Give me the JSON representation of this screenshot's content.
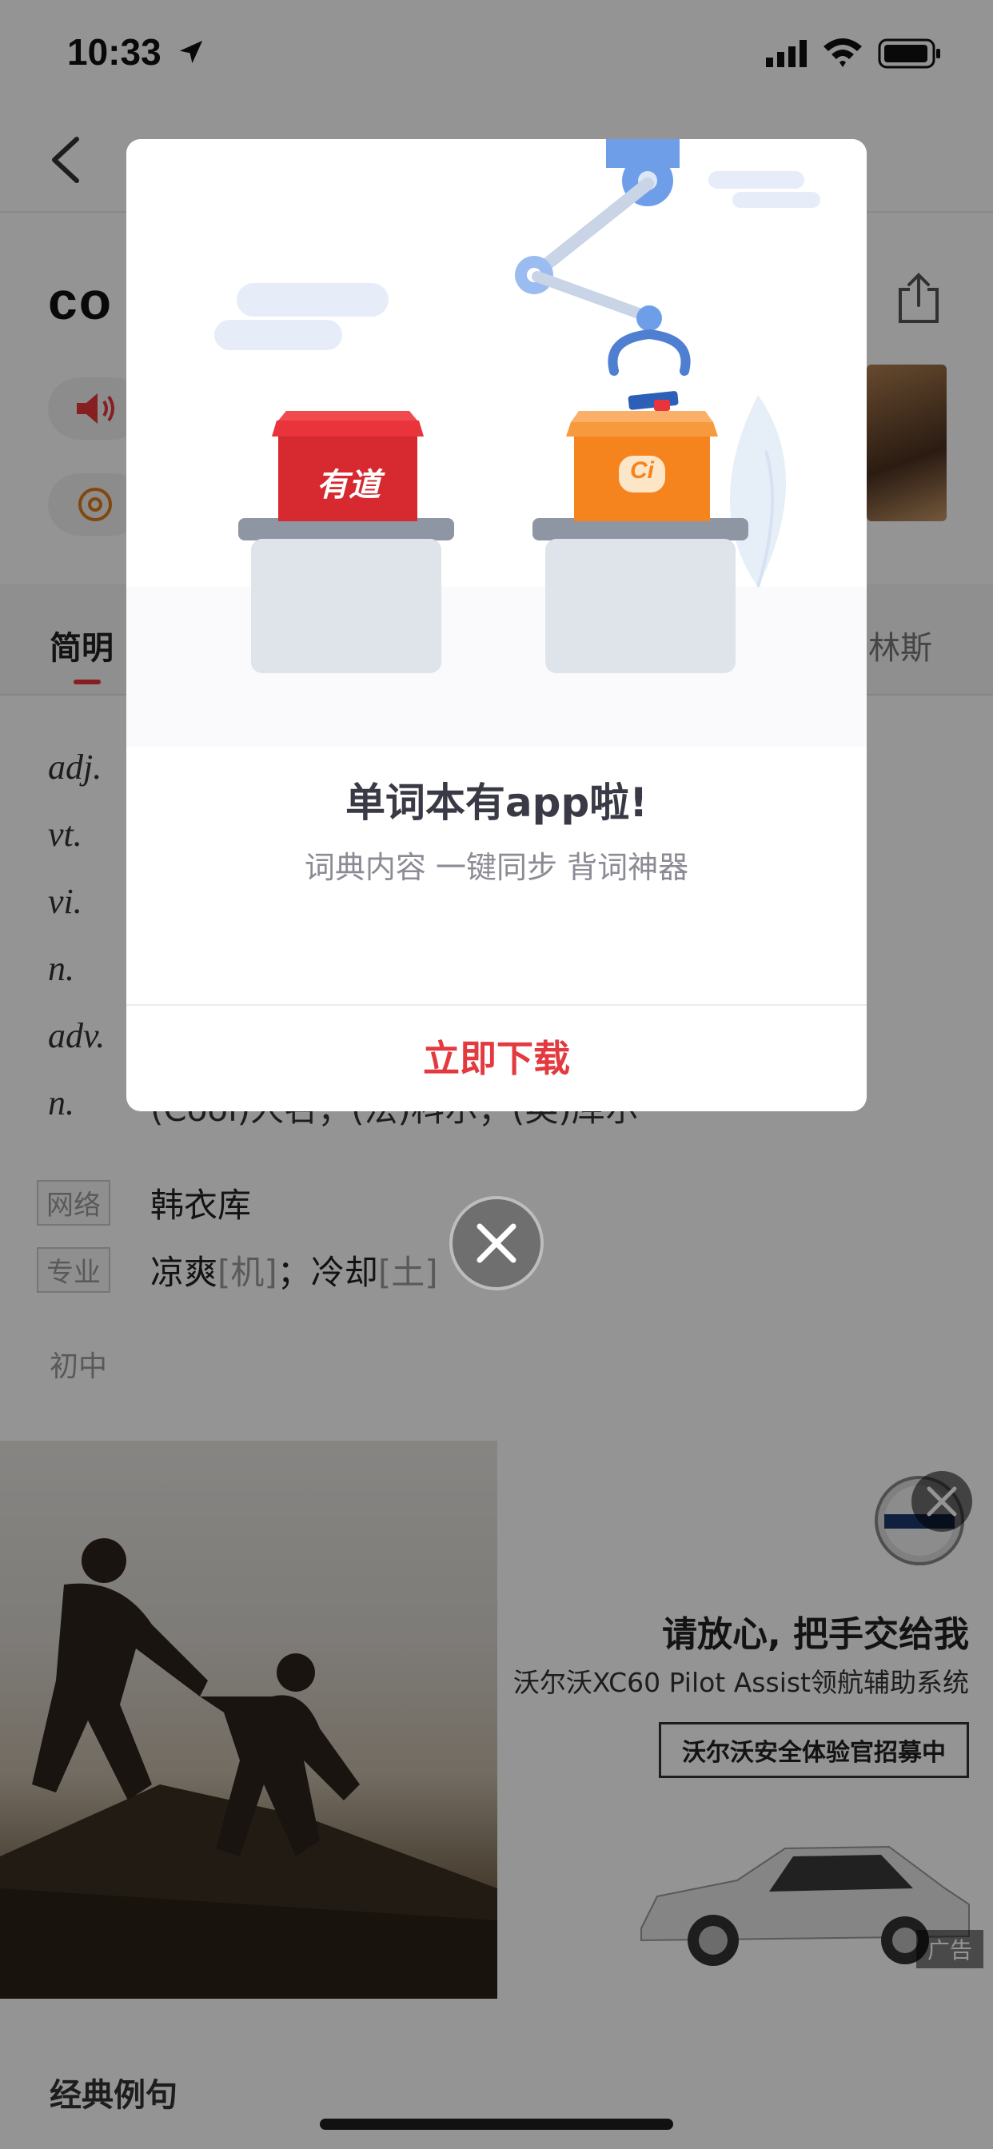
{
  "status_bar": {
    "time": "10:33"
  },
  "nav": {
    "title": ""
  },
  "word": {
    "headword": "co"
  },
  "tabs": {
    "simple": "简明",
    "collins": "林斯"
  },
  "definitions": [
    {
      "pos": "adj.",
      "text": ""
    },
    {
      "pos": "vt.",
      "text": ""
    },
    {
      "pos": "vi.",
      "text": ""
    },
    {
      "pos": "n.",
      "text": ""
    },
    {
      "pos": "adv.",
      "text": ""
    },
    {
      "pos": "n.",
      "text": "(Cool)人名；(法)科尔；(英)库尔"
    }
  ],
  "tags": [
    {
      "label": "网络",
      "text": "韩衣库",
      "sub": ""
    },
    {
      "label": "专业",
      "text": "凉爽",
      "sub": "[机]",
      "text2": "；冷却",
      "sub2": "[土]"
    }
  ],
  "level": "初中",
  "ad": {
    "headline": "请放心, 把手交给我",
    "sub": "沃尔沃XC60 Pilot Assist领航辅助系统",
    "box": "沃尔沃安全体验官招募中",
    "brand": "VOLVO",
    "tag": "广告"
  },
  "examples_title": "经典例句",
  "modal": {
    "title": "单词本有app啦!",
    "subtitle": "词典内容 一键同步 背词神器",
    "cta": "立即下载",
    "box_left_label": "有道",
    "box_right_label": "Ci"
  },
  "colors": {
    "accent": "#e33a3f",
    "box_red": "#e8343a",
    "box_orange": "#f5841f",
    "arm_blue": "#6f9ee8"
  }
}
